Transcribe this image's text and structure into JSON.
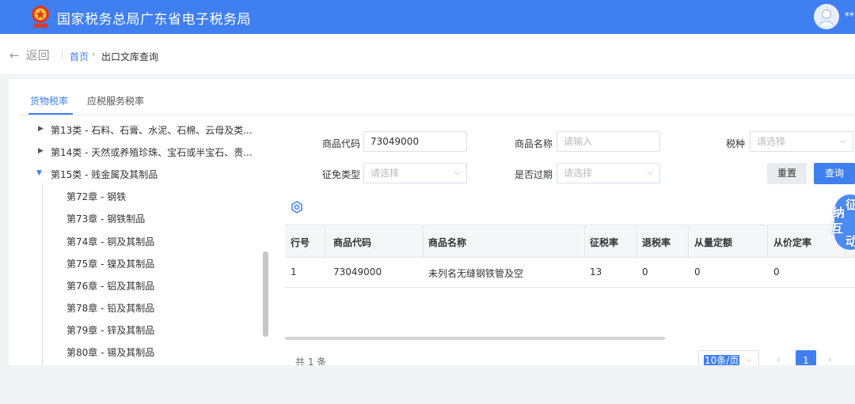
{
  "header": {
    "site_title": "国家税务总局广东省电子税务局",
    "user_name": "**",
    "colors": {
      "header_bg": "#3f7ff0",
      "accent": "#3f7ff0"
    }
  },
  "nav": {
    "back_label": "返回",
    "breadcrumb_home": "首页",
    "breadcrumb_current": "出口文库查询"
  },
  "tabs": [
    {
      "label": "货物税率",
      "active": true
    },
    {
      "label": "应税服务税率",
      "active": false
    }
  ],
  "tree": {
    "categories": [
      {
        "label": "第13类 - 石料、石膏、水泥、石棉、云母及类...",
        "expanded": false
      },
      {
        "label": "第14类 - 天然或养殖珍珠、宝石或半宝石、贵...",
        "expanded": false
      },
      {
        "label": "第15类 - 贱金属及其制品",
        "expanded": true
      }
    ],
    "chapters": [
      "第72章 - 钢铁",
      "第73章 - 钢铁制品",
      "第74章 - 铜及其制品",
      "第75章 - 镍及其制品",
      "第76章 - 铝及其制品",
      "第78章 - 铅及其制品",
      "第79章 - 锌及其制品",
      "第80章 - 锡及其制品"
    ]
  },
  "form": {
    "product_code": {
      "label": "商品代码",
      "value": "73049000"
    },
    "product_name": {
      "label": "商品名称",
      "placeholder": "请输入"
    },
    "tax_type": {
      "label": "税种",
      "placeholder": "请选择"
    },
    "levy_type": {
      "label": "征免类型",
      "placeholder": "请选择"
    },
    "expired": {
      "label": "是否过期",
      "placeholder": "请选择"
    },
    "reset_label": "重置",
    "query_label": "查询"
  },
  "table": {
    "columns": [
      "行号",
      "商品代码",
      "商品名称",
      "征税率",
      "退税率",
      "从量定额",
      "从价定率"
    ],
    "rows": [
      [
        "1",
        "73049000",
        "未列名无缝钢铁管及空",
        "13",
        "0",
        "0",
        "0"
      ]
    ]
  },
  "pagination": {
    "total_text": "共 1 条",
    "page_size": "10条/页",
    "current_page": "1"
  },
  "float_widget": {
    "chars": [
      "纳",
      "互",
      "征",
      "动"
    ]
  }
}
